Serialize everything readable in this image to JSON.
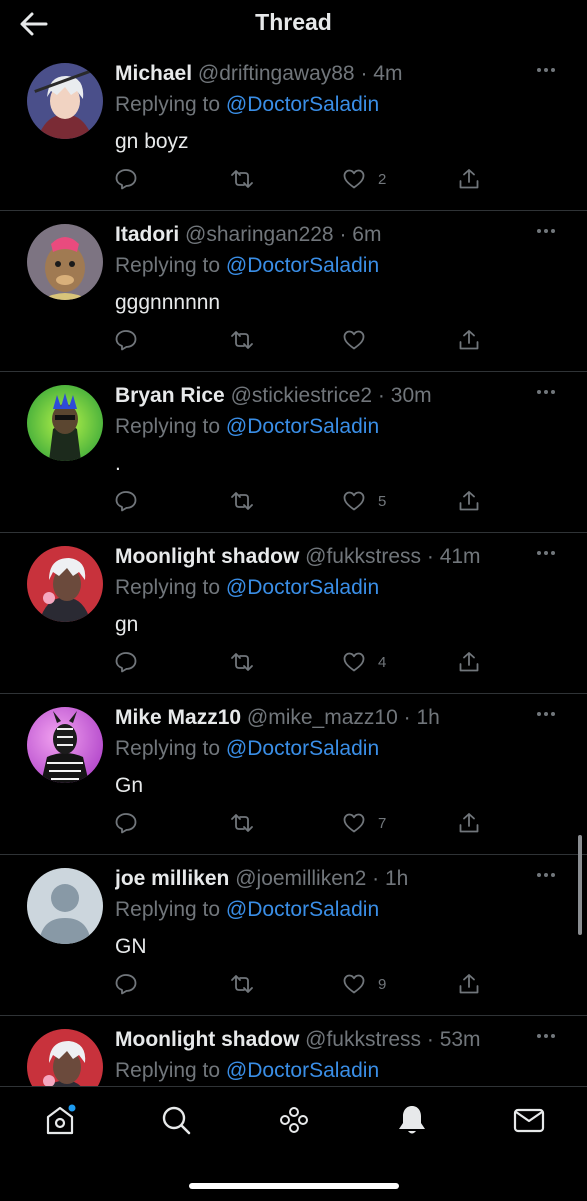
{
  "header": {
    "title": "Thread",
    "back_icon": "arrow-left-icon"
  },
  "colors": {
    "background": "#000000",
    "text": "#e7e9ea",
    "muted": "#71767b",
    "link": "#3a8ee6",
    "notification_dot": "#1d9bf0"
  },
  "tweets": [
    {
      "name": "Michael",
      "handle": "@driftingaway88",
      "separator": "·",
      "time": "4m",
      "replying_prefix": "Replying to",
      "replying_handle": "@DoctorSaladin",
      "text": "gn boyz",
      "likes": "2"
    },
    {
      "name": "Itadori",
      "handle": "@sharingan228",
      "separator": "·",
      "time": "6m",
      "replying_prefix": "Replying to",
      "replying_handle": "@DoctorSaladin",
      "text": "gggnnnnnn",
      "likes": ""
    },
    {
      "name": "Bryan Rice",
      "handle": "@stickiestrice2",
      "separator": "·",
      "time": "30m",
      "replying_prefix": "Replying to",
      "replying_handle": "@DoctorSaladin",
      "text": ".",
      "likes": "5"
    },
    {
      "name": "Moonlight shadow",
      "handle": "@fukkstress",
      "separator": "·",
      "time": "41m",
      "replying_prefix": "Replying to",
      "replying_handle": "@DoctorSaladin",
      "text": "gn",
      "likes": "4"
    },
    {
      "name": "Mike Mazz10",
      "handle": "@mike_mazz10",
      "separator": "·",
      "time": "1h",
      "replying_prefix": "Replying to",
      "replying_handle": "@DoctorSaladin",
      "text": "Gn",
      "likes": "7"
    },
    {
      "name": "joe milliken",
      "handle": "@joemilliken2",
      "separator": "·",
      "time": "1h",
      "replying_prefix": "Replying to",
      "replying_handle": "@DoctorSaladin",
      "text": "GN",
      "likes": "9"
    },
    {
      "name": "Moonlight shadow",
      "handle": "@fukkstress",
      "separator": "·",
      "time": "53m",
      "replying_prefix": "Replying to",
      "replying_handle": "@DoctorSaladin",
      "text": "",
      "likes": ""
    }
  ],
  "bottom_nav": {
    "items": [
      "home-icon",
      "search-icon",
      "spaces-icon",
      "notifications-icon",
      "messages-icon"
    ],
    "active": "notifications-icon",
    "home_has_notification_dot": true
  }
}
